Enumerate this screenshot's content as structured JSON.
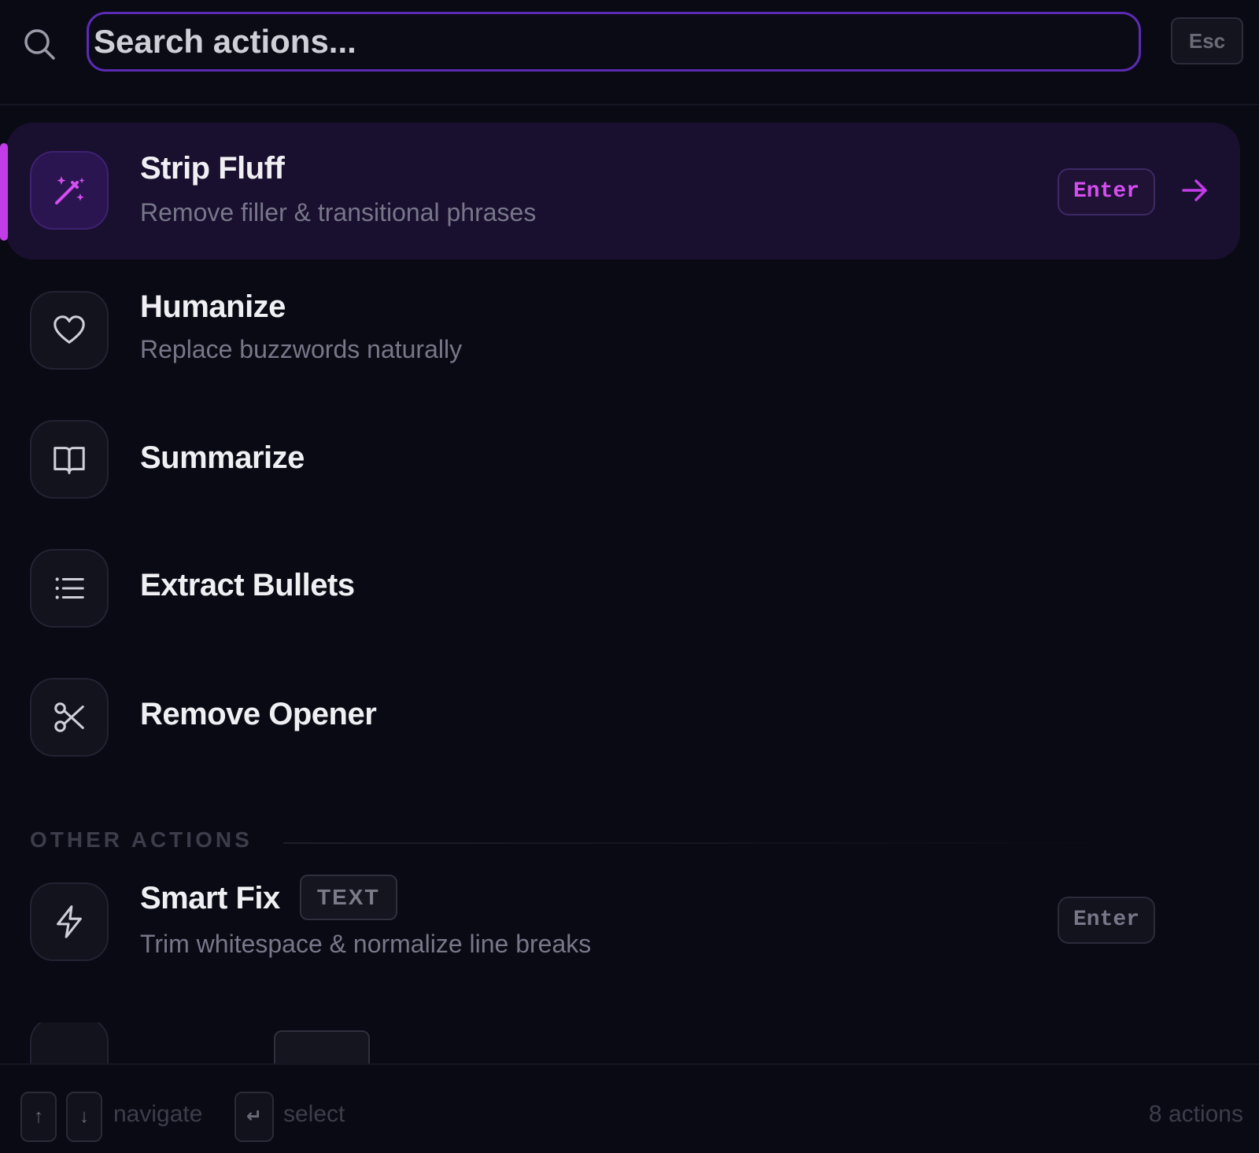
{
  "search": {
    "placeholder": "Search actions...",
    "esc_label": "Esc"
  },
  "actions": [
    {
      "title": "Strip Fluff",
      "description": "Remove filler & transitional phrases",
      "icon": "magic-wand-icon",
      "shortcut": "Enter",
      "active": true
    },
    {
      "title": "Humanize",
      "description": "Replace buzzwords naturally",
      "icon": "heart-icon"
    },
    {
      "title": "Summarize",
      "icon": "book-open-icon"
    },
    {
      "title": "Extract Bullets",
      "icon": "list-icon"
    },
    {
      "title": "Remove Opener",
      "icon": "scissors-icon"
    }
  ],
  "other_section": {
    "label": "OTHER ACTIONS",
    "items": [
      {
        "title": "Smart Fix",
        "tag": "TEXT",
        "description": "Trim whitespace & normalize line breaks",
        "icon": "lightning-icon",
        "shortcut": "Enter"
      }
    ]
  },
  "footer": {
    "up_key": "↑",
    "down_key": "↓",
    "navigate_label": "navigate",
    "enter_key": "↵",
    "select_label": "select",
    "count_label": "8 actions"
  },
  "colors": {
    "accent": "#c23ce8",
    "active_row_bg": "#190f2e",
    "search_border": "#5b2bb3",
    "background": "#0a0a14"
  }
}
